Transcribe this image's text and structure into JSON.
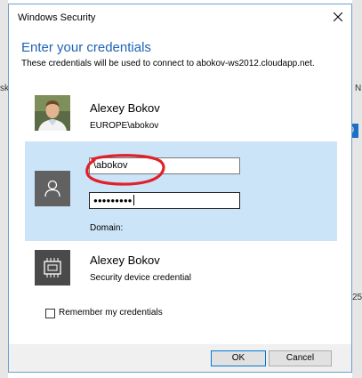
{
  "background": {
    "left_text_1": "sk",
    "right_text_1": "N",
    "right_badge": "9",
    "right_text_2": "25"
  },
  "window": {
    "title": "Windows Security",
    "close_icon": "close-icon"
  },
  "header": {
    "heading": "Enter your credentials",
    "subtext": "These credentials will be used to connect to abokov-ws2012.cloudapp.net."
  },
  "credentials": {
    "user": {
      "name": "Alexey Bokov",
      "account": "EUROPE\\abokov",
      "icon": "user-photo-icon"
    },
    "selected": {
      "icon": "person-icon",
      "username_value": "\\abokov",
      "password_mask": "●●●●●●●●●",
      "domain_label": "Domain:"
    },
    "device": {
      "name": "Alexey Bokov",
      "description": "Security device credential",
      "icon": "chip-icon"
    }
  },
  "remember": {
    "label": "Remember my credentials",
    "checked": false
  },
  "buttons": {
    "ok": "OK",
    "cancel": "Cancel"
  },
  "colors": {
    "accent": "#1e63b6",
    "selection": "#cce4f7",
    "annotation": "#e0202a"
  }
}
